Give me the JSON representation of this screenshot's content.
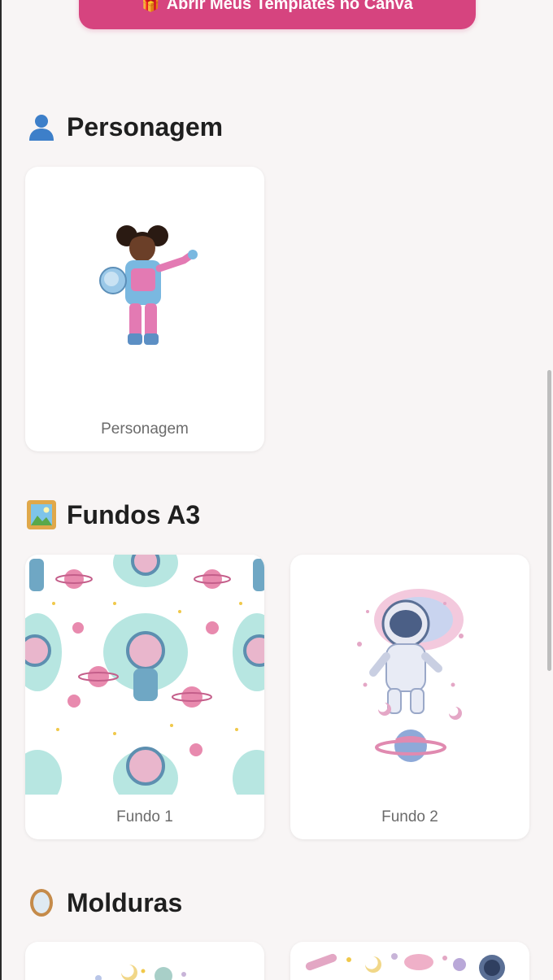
{
  "cta": {
    "label": "Abrir Meus Templates no Canva",
    "icon": "gift-icon"
  },
  "sections": [
    {
      "title": "Personagem",
      "icon": "person-icon",
      "cards": [
        {
          "label": "Personagem",
          "image": "astronaut-girl-illustration"
        }
      ]
    },
    {
      "title": "Fundos A3",
      "icon": "framed-picture-icon",
      "cards": [
        {
          "label": "Fundo 1",
          "image": "astronaut-pattern-background"
        },
        {
          "label": "Fundo 2",
          "image": "astronaut-planet-background"
        }
      ]
    },
    {
      "title": "Molduras",
      "icon": "oval-mirror-icon",
      "cards": [
        {
          "label": "",
          "image": "moon-planet-frame"
        },
        {
          "label": "",
          "image": "rocket-stars-frame"
        }
      ]
    }
  ],
  "colors": {
    "accent": "#d6447f",
    "background": "#f8f5f5",
    "card": "#ffffff"
  }
}
